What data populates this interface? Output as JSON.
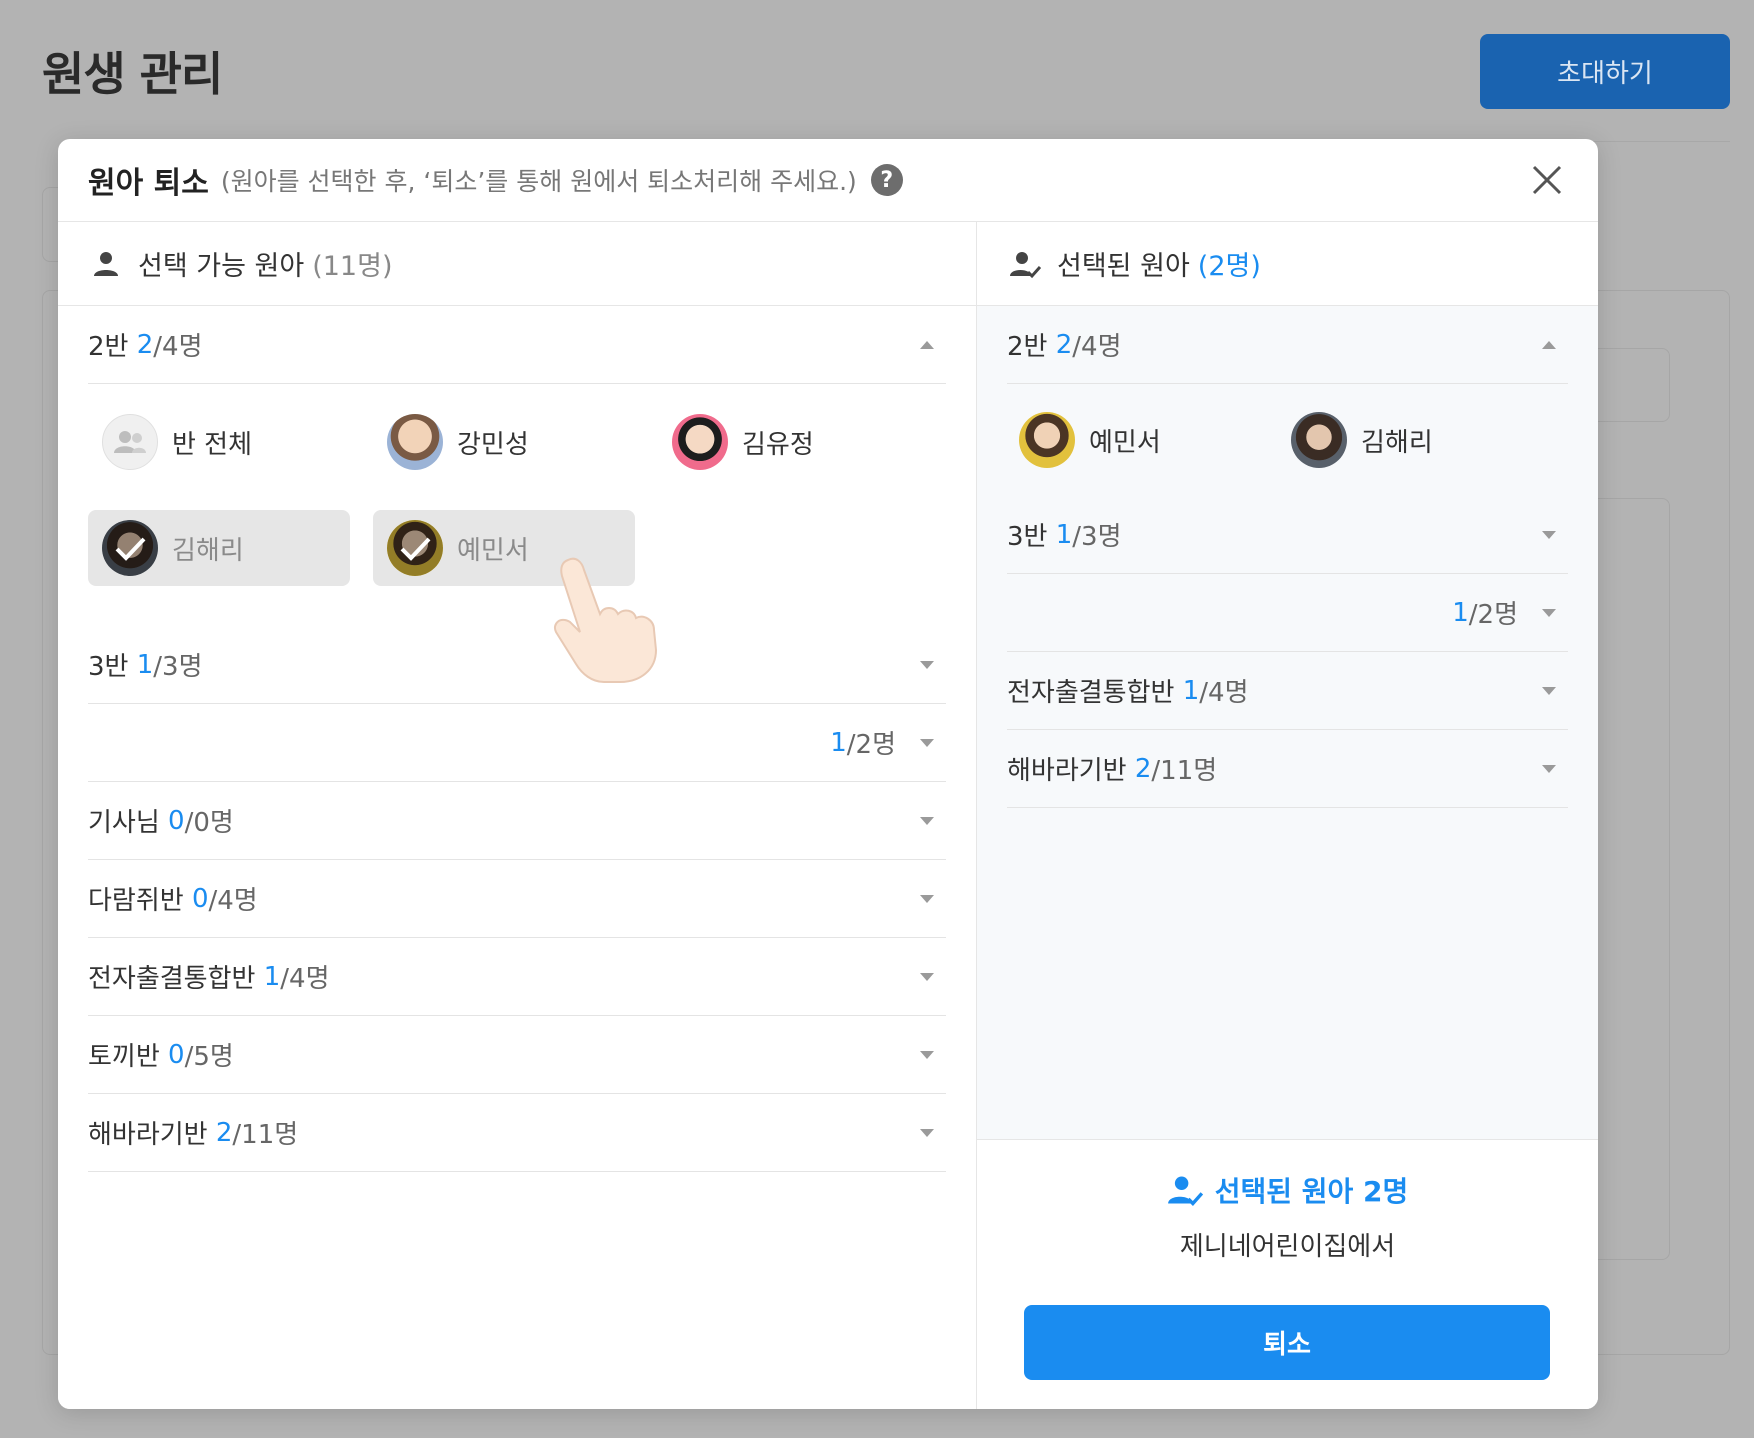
{
  "page": {
    "title": "원생 관리",
    "invite_label": "초대하기"
  },
  "modal": {
    "title": "원아 퇴소",
    "subtitle": "(원아를 선택한 후, ‘퇴소’를 통해 원에서 퇴소처리해 주세요.)",
    "help": "?"
  },
  "left": {
    "heading": "선택 가능 원아",
    "count": "(11명)",
    "open_group": {
      "name": "2반",
      "num": "2",
      "total": "/4명"
    },
    "children": [
      {
        "name": "반 전체",
        "selected": false,
        "avatar": "group-icon"
      },
      {
        "name": "강민성",
        "selected": false,
        "avatar": "child-photo"
      },
      {
        "name": "김유정",
        "selected": false,
        "avatar": "child-photo"
      },
      {
        "name": "김해리",
        "selected": true,
        "avatar": "child-photo"
      },
      {
        "name": "예민서",
        "selected": true,
        "avatar": "child-photo"
      }
    ],
    "groups": [
      {
        "name": "3반",
        "num": "1",
        "total": "/3명"
      },
      {
        "name": "",
        "num": "1",
        "total": "/2명"
      },
      {
        "name": "기사님",
        "num": "0",
        "total": "/0명"
      },
      {
        "name": "다람쥐반",
        "num": "0",
        "total": "/4명"
      },
      {
        "name": "전자출결통합반",
        "num": "1",
        "total": "/4명"
      },
      {
        "name": "토끼반",
        "num": "0",
        "total": "/5명"
      },
      {
        "name": "해바라기반",
        "num": "2",
        "total": "/11명"
      }
    ]
  },
  "right": {
    "heading": "선택된 원아",
    "count": "(2명)",
    "open_group": {
      "name": "2반",
      "num": "2",
      "total": "/4명"
    },
    "children": [
      {
        "name": "예민서"
      },
      {
        "name": "김해리"
      }
    ],
    "groups": [
      {
        "name": "3반",
        "num": "1",
        "total": "/3명"
      },
      {
        "name": "",
        "num": "1",
        "total": "/2명"
      },
      {
        "name": "전자출결통합반",
        "num": "1",
        "total": "/4명"
      },
      {
        "name": "해바라기반",
        "num": "2",
        "total": "/11명"
      }
    ],
    "footer": {
      "selected_text": "선택된 원아 2명",
      "sub_text": "제니네어린이집에서",
      "button_label": "퇴소"
    }
  },
  "colors": {
    "accent": "#1a8cf0",
    "invite": "#1a63b0"
  }
}
